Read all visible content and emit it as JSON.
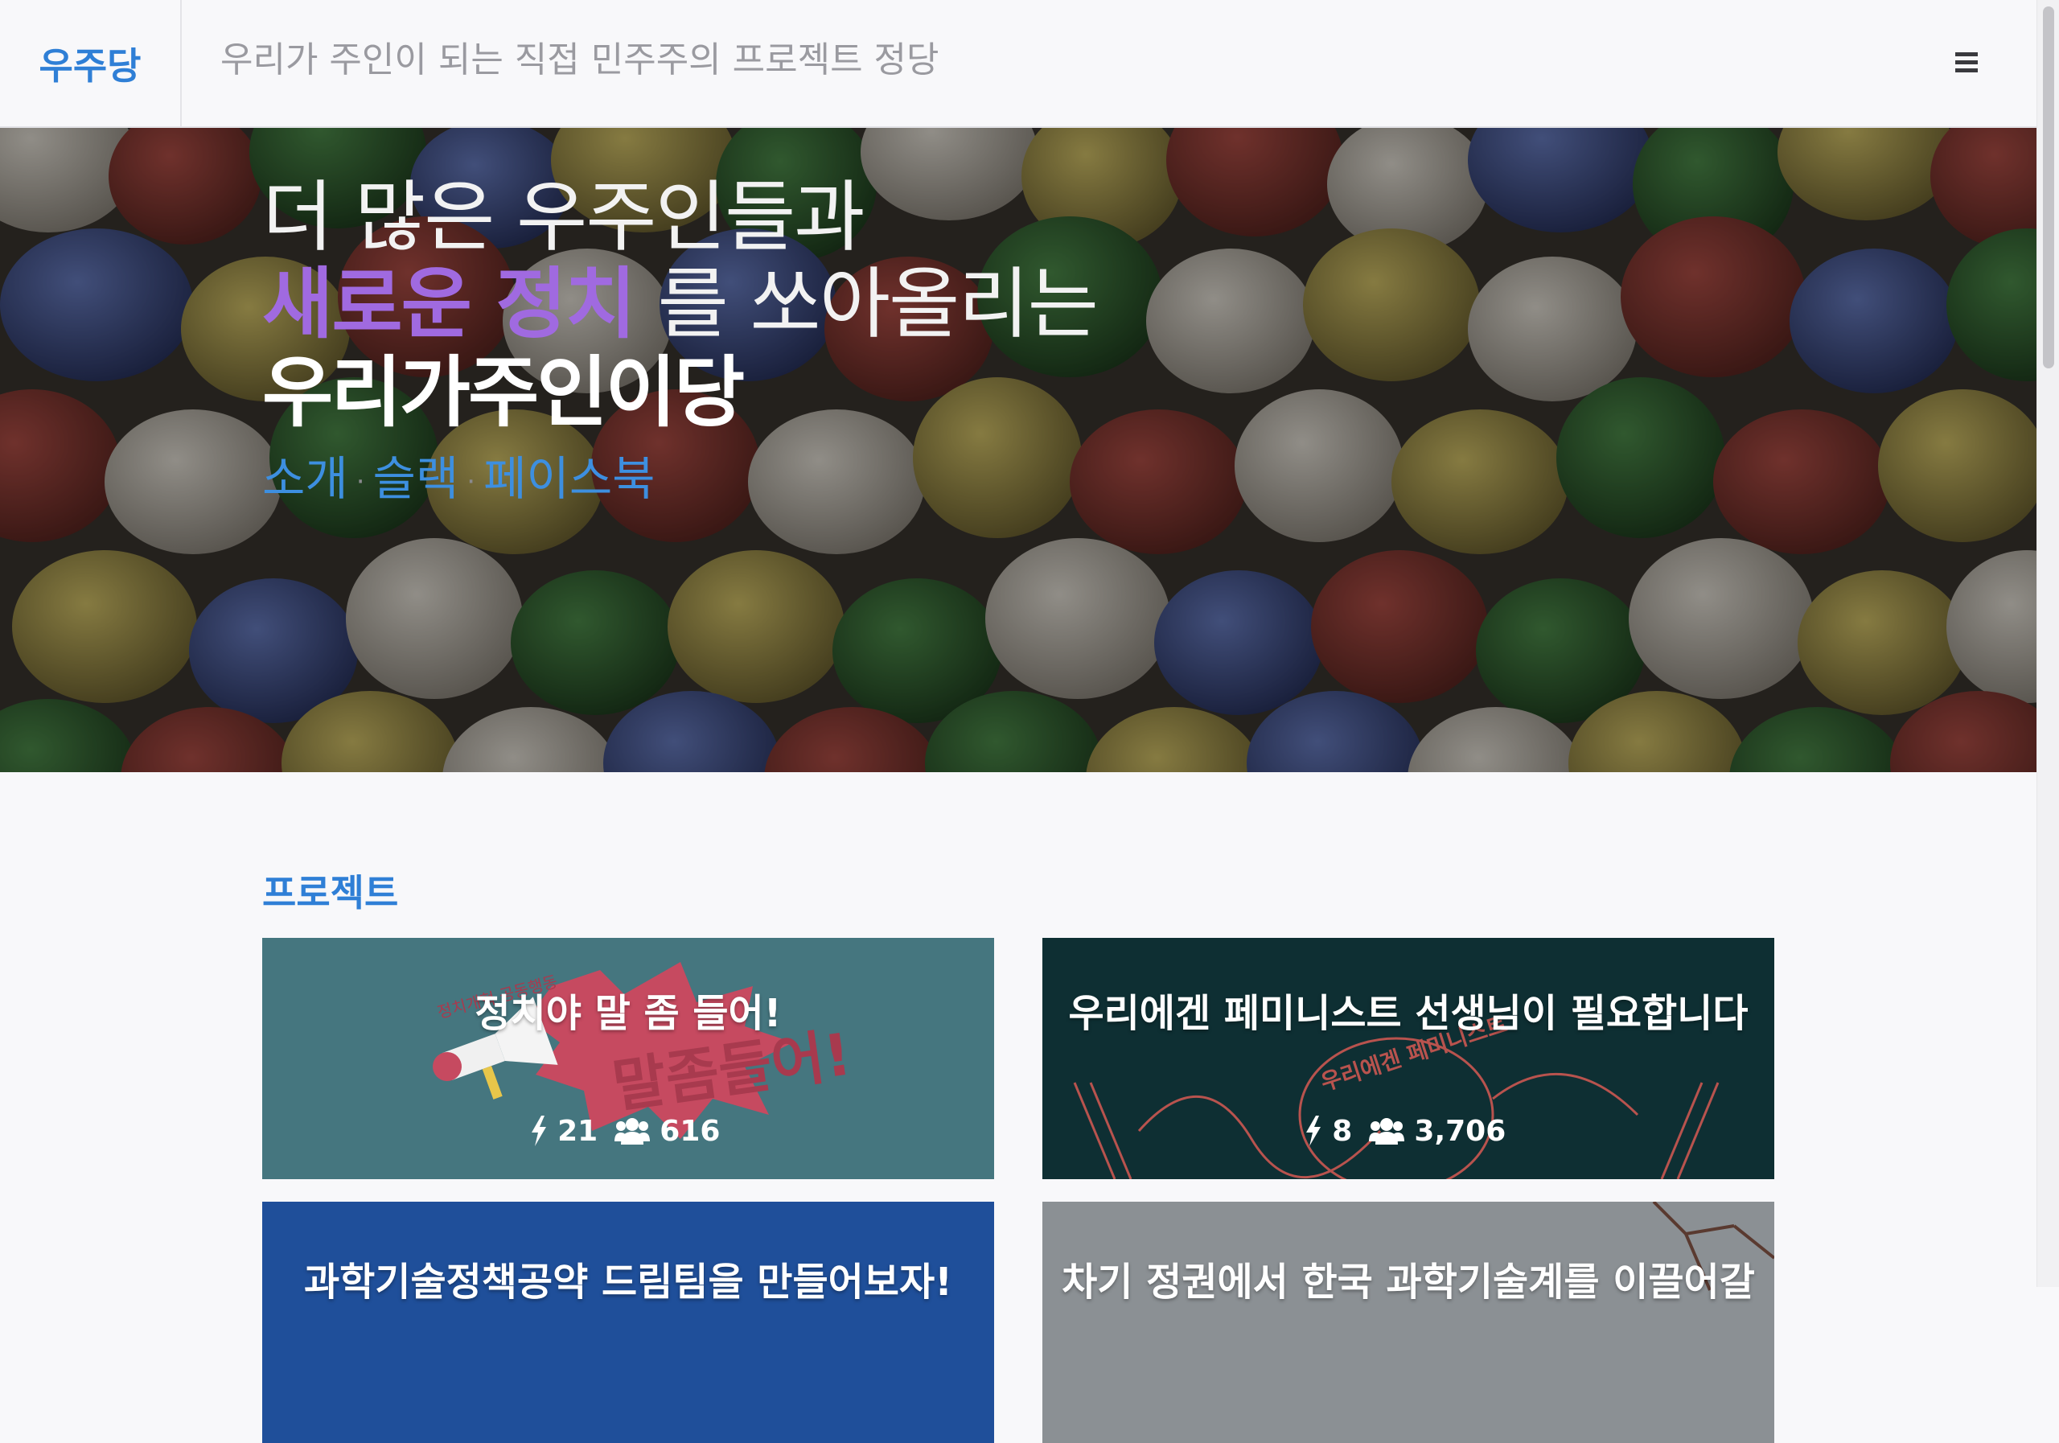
{
  "header": {
    "brand": "우주당",
    "tagline": "우리가 주인이 되는 직접 민주주의 프로젝트 정당",
    "menu_icon": "hamburger-menu-icon"
  },
  "hero": {
    "line1": "더 많은 우주인들과",
    "line2_accent": "새로운 정치",
    "line2_rest": " 를 쏘아올리는",
    "line3": "우리가주인이당",
    "links": [
      "소개",
      "슬랙",
      "페이스북"
    ],
    "separator": "·",
    "accent_color": "#a06ae0",
    "link_color": "#3d8fe0"
  },
  "projects": {
    "title": "프로젝트",
    "items": [
      {
        "title": "정치야 말 좀 들어!",
        "actions": "21",
        "members": "616",
        "bg": "#45767f",
        "art_main": "말좀들어!",
        "art_small": "정치개혁 공동행동"
      },
      {
        "title": "우리에겐 페미니스트 선생님이 필요합니다",
        "actions": "8",
        "members": "3,706",
        "bg": "#0e2f33",
        "art_main": "우리에겐 페미니스트"
      },
      {
        "title": "과학기술정책공약 드림팀을 만들어보자!",
        "bg": "#1f4f9a"
      },
      {
        "title": "차기 정권에서 한국 과학기술계를 이끌어갈",
        "bg": "#8a8f93"
      }
    ]
  },
  "icons": {
    "actions": "bolt-icon",
    "members": "users-icon"
  }
}
